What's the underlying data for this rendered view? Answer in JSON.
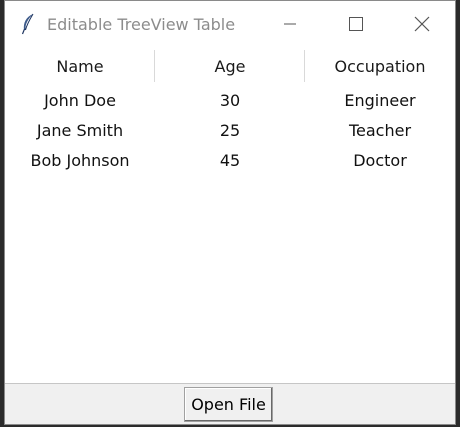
{
  "window": {
    "title": "Editable TreeView Table",
    "icons": {
      "app": "feather-icon",
      "minimize": "minimize-icon",
      "maximize": "maximize-icon",
      "close": "close-icon"
    }
  },
  "table": {
    "columns": [
      "Name",
      "Age",
      "Occupation"
    ],
    "rows": [
      [
        "John Doe",
        "30",
        "Engineer"
      ],
      [
        "Jane Smith",
        "25",
        "Teacher"
      ],
      [
        "Bob Johnson",
        "45",
        "Doctor"
      ]
    ]
  },
  "actions": {
    "open_file_label": "Open File"
  },
  "colors": {
    "title_text": "#8c8c8c",
    "window_bg": "#f0f0f0",
    "table_bg": "#ffffff",
    "desktop_bg": "#2b2b2b"
  }
}
